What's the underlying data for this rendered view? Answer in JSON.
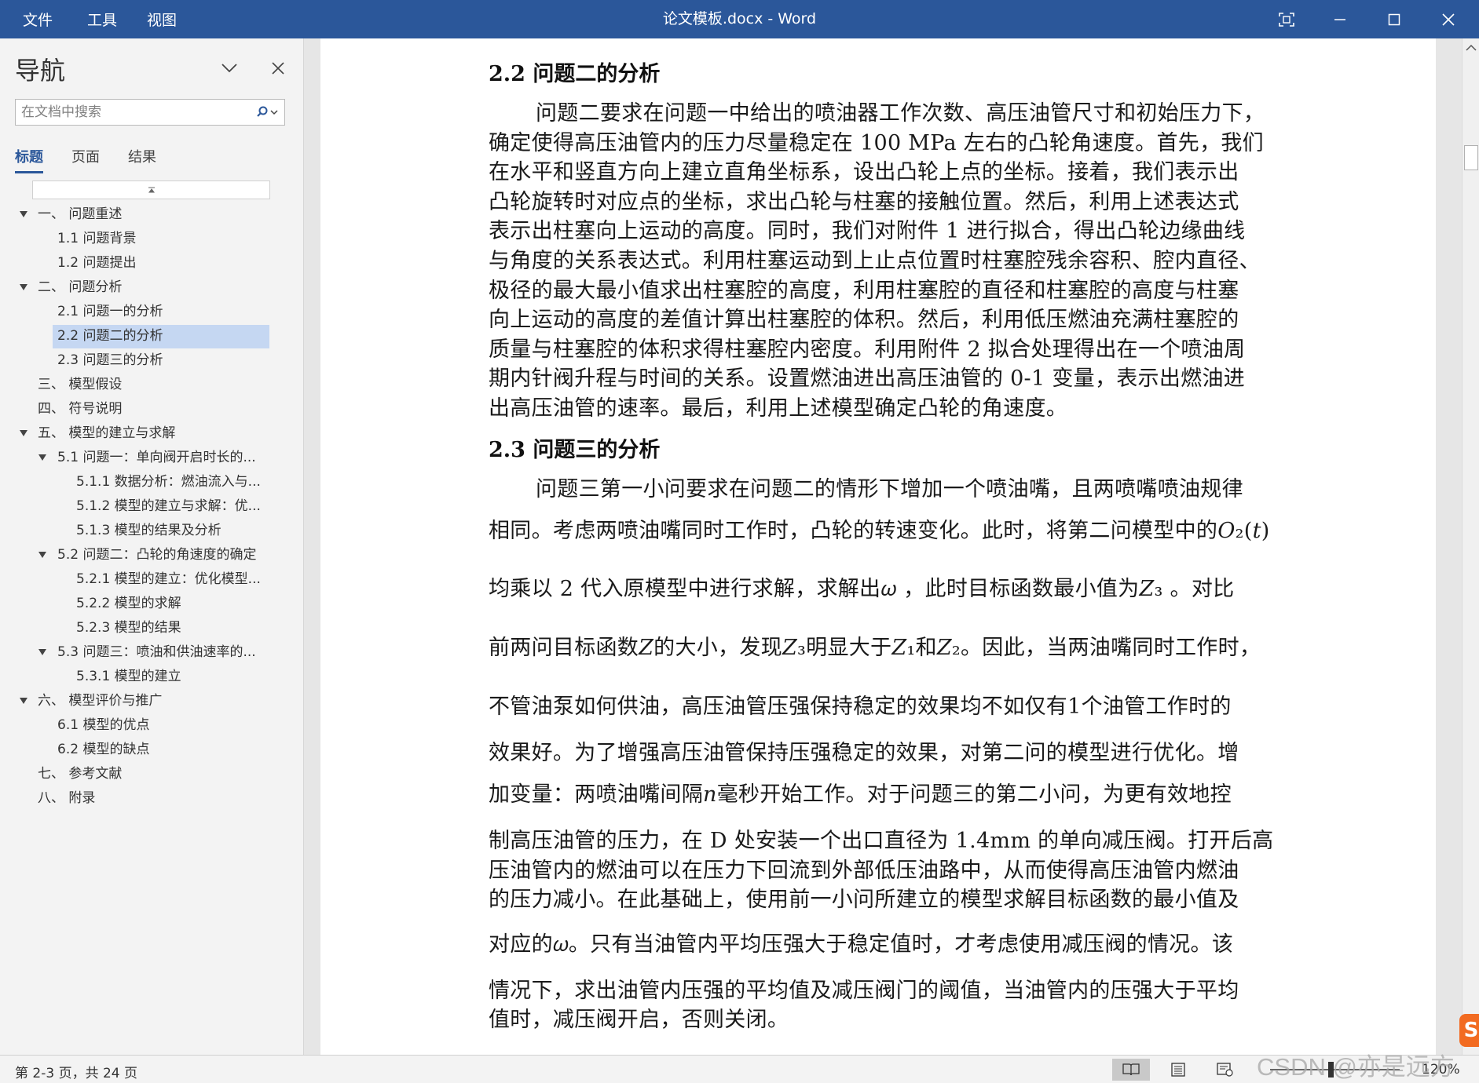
{
  "menu": {
    "file": "文件",
    "tools": "工具",
    "view": "视图"
  },
  "window_title": "论文模板.docx  -  Word",
  "nav": {
    "title": "导航",
    "search_placeholder": "在文档中搜索",
    "tabs": [
      "标题",
      "页面",
      "结果"
    ],
    "items": [
      {
        "label": "一、 问题重述",
        "level": 0,
        "expanded": true
      },
      {
        "label": "1.1 问题背景",
        "level": 1
      },
      {
        "label": "1.2 问题提出",
        "level": 1
      },
      {
        "label": "二、 问题分析",
        "level": 0,
        "expanded": true
      },
      {
        "label": "2.1 问题一的分析",
        "level": 1
      },
      {
        "label": "2.2 问题二的分析",
        "level": 1,
        "selected": true
      },
      {
        "label": "2.3 问题三的分析",
        "level": 1
      },
      {
        "label": "三、 模型假设",
        "level": 0
      },
      {
        "label": "四、 符号说明",
        "level": 0
      },
      {
        "label": "五、 模型的建立与求解",
        "level": 0,
        "expanded": true
      },
      {
        "label": "5.1 问题一：单向阀开启时长的...",
        "level": 1,
        "expanded": true
      },
      {
        "label": "5.1.1 数据分析：燃油流入与...",
        "level": 2
      },
      {
        "label": "5.1.2 模型的建立与求解：优...",
        "level": 2
      },
      {
        "label": "5.1.3 模型的结果及分析",
        "level": 2
      },
      {
        "label": "5.2 问题二：凸轮的角速度的确定",
        "level": 1,
        "expanded": true
      },
      {
        "label": "5.2.1 模型的建立：优化模型...",
        "level": 2
      },
      {
        "label": "5.2.2 模型的求解",
        "level": 2
      },
      {
        "label": "5.2.3 模型的结果",
        "level": 2
      },
      {
        "label": "5.3 问题三：喷油和供油速率的...",
        "level": 1,
        "expanded": true
      },
      {
        "label": "5.3.1 模型的建立",
        "level": 2
      },
      {
        "label": "六、 模型评价与推广",
        "level": 0,
        "expanded": true
      },
      {
        "label": "6.1 模型的优点",
        "level": 1
      },
      {
        "label": "6.2 模型的缺点",
        "level": 1
      },
      {
        "label": "七、 参考文献",
        "level": 0
      },
      {
        "label": "八、 附录",
        "level": 0
      }
    ]
  },
  "document": {
    "heading_2_2": "2.2 问题二的分析",
    "para_2_2": [
      "问题二要求在问题一中给出的喷油器工作次数、高压油管尺寸和初始压力下，",
      "确定使得高压油管内的压力尽量稳定在 100 MPa 左右的凸轮角速度。首先，我们",
      "在水平和竖直方向上建立直角坐标系，设出凸轮上点的坐标。接着，我们表示出",
      "凸轮旋转时对应点的坐标，求出凸轮与柱塞的接触位置。然后，利用上述表达式",
      "表示出柱塞向上运动的高度。同时，我们对附件 1 进行拟合，得出凸轮边缘曲线",
      "与角度的关系表达式。利用柱塞运动到上止点位置时柱塞腔残余容积、腔内直径、",
      "极径的最大最小值求出柱塞腔的高度，利用柱塞腔的直径和柱塞腔的高度与柱塞",
      "向上运动的高度的差值计算出柱塞腔的体积。然后，利用低压燃油充满柱塞腔的",
      "质量与柱塞腔的体积求得柱塞腔内密度。利用附件 2 拟合处理得出在一个喷油周",
      "期内针阀升程与时间的关系。设置燃油进出高压油管的 0-1 变量，表示出燃油进",
      "出高压油管的速率。最后，利用上述模型确定凸轮的角速度。"
    ],
    "heading_2_3": "2.3 问题三的分析",
    "para_2_3": [
      "问题三第一小问要求在问题二的情形下增加一个喷油嘴，且两喷嘴喷油规律",
      "相同。考虑两喷油嘴同时工作时，凸轮的转速变化。此时，将第二问模型中的𝑂₂(𝑡)",
      "均乘以 2 代入原模型中进行求解，求解出𝜔 ，此时目标函数最小值为𝑍₃ 。对比",
      "前两问目标函数𝑍的大小，发现𝑍₃明显大于𝑍₁和𝑍₂。因此，当两油嘴同时工作时，",
      "不管油泵如何供油，高压油管压强保持稳定的效果均不如仅有1个油管工作时的",
      "效果好。为了增强高压油管保持压强稳定的效果，对第二问的模型进行优化。增",
      "加变量：两喷油嘴间隔𝑛毫秒开始工作。对于问题三的第二小问，为更有效地控",
      "制高压油管的压力，在 D 处安装一个出口直径为 1.4mm 的单向减压阀。打开后高",
      "压油管内的燃油可以在压力下回流到外部低压油路中，从而使得高压油管内燃油",
      "的压力减小。在此基础上，使用前一小问所建立的模型求解目标函数的最小值及",
      "对应的𝜔。只有当油管内平均压强大于稳定值时，才考虑使用减压阀的情况。该",
      "情况下，求出油管内压强的平均值及减压阀门的阈值，当油管内的压强大于平均",
      "值时，减压阀开启，否则关闭。"
    ]
  },
  "status": {
    "page_info": "第 2-3 页，共 24 页",
    "zoom": "120%",
    "watermark": "CSDN @亦是远方"
  }
}
